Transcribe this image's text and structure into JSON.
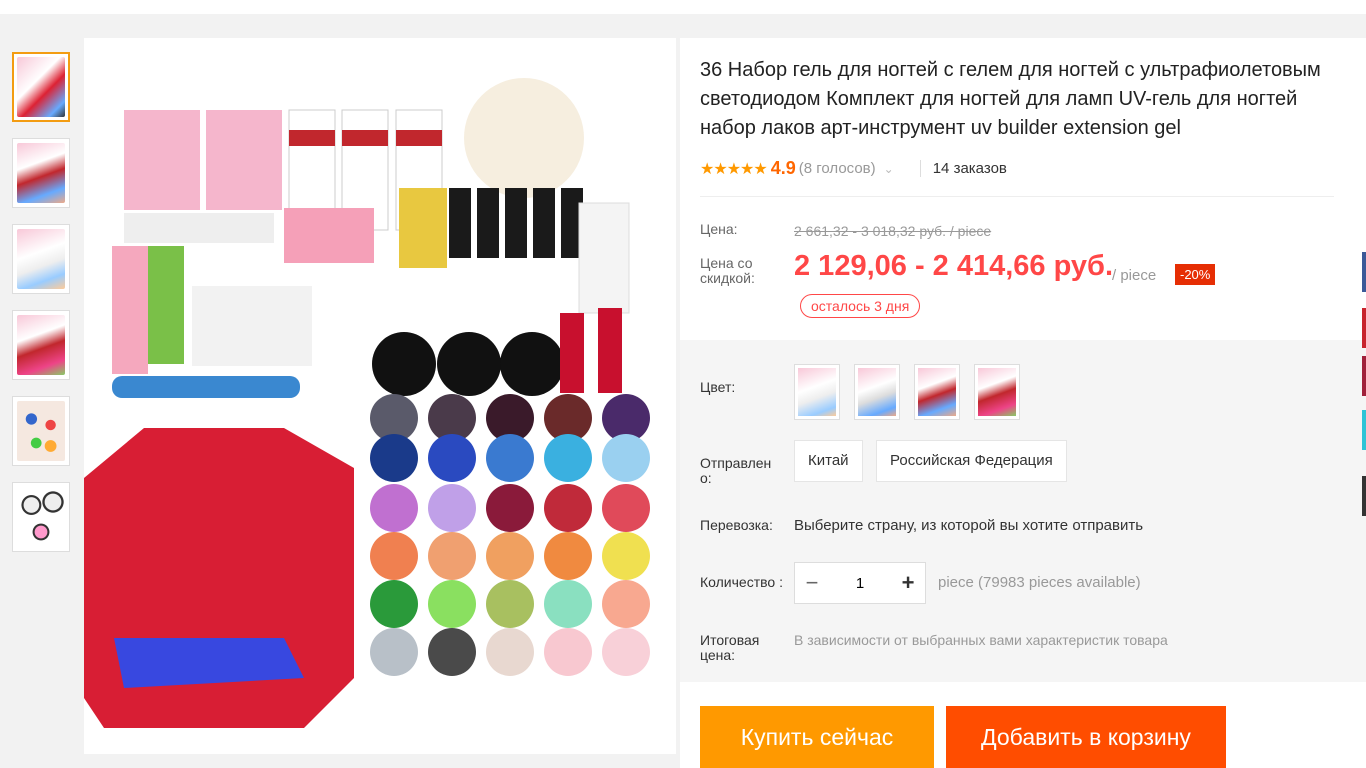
{
  "product": {
    "title": "36 Набор гель для ногтей с гелем для ногтей с ультрафиолетовым светодиодом Комплект для ногтей для ламп UV-гель для ногтей набор лаков арт-инструмент uv builder extension gel",
    "rating_stars": "★★★★★",
    "rating_score": "4.9",
    "rating_votes": "(8 голосов)",
    "orders": "14 заказов"
  },
  "price": {
    "label": "Цена:",
    "original": "2 661,32 - 3 018,32 руб. / piece",
    "discount_label": "Цена со скидкой:",
    "discounted": "2 129,06 - 2 414,66 руб.",
    "per_unit": "/ piece",
    "discount_badge": "-20%",
    "days_left": "осталось 3 дня"
  },
  "sku": {
    "color_label": "Цвет:",
    "ship_from_label": "Отправлен о:",
    "ship_from_options": [
      "Китай",
      "Российская Федерация"
    ],
    "shipping_label": "Перевозка:",
    "shipping_value": "Выберите страну, из которой вы хотите отправить",
    "quantity_label": "Количество :",
    "quantity_value": "1",
    "available": "piece (79983 pieces available)",
    "total_label": "Итоговая цена:",
    "total_value": "В зависимости от выбранных вами характеристик товара"
  },
  "actions": {
    "buy_now": "Купить сейчас",
    "add_to_cart": "Добавить в корзину"
  },
  "colors": {
    "accent_orange": "#ff9900",
    "cart_orange": "#ff4d00",
    "price_red": "#ff4747",
    "badge_red": "#e62e04"
  }
}
